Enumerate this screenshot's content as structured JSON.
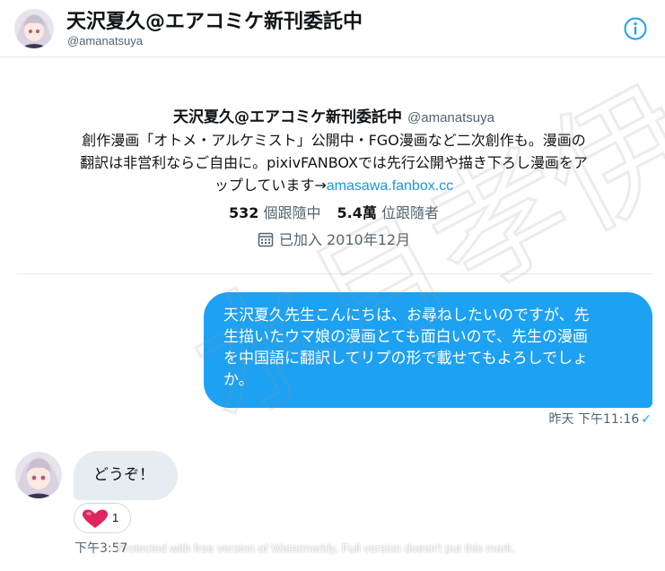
{
  "header": {
    "display_name": "天沢夏久@エアコミケ新刊委託中",
    "handle": "@amanatsuya",
    "info_icon": "info-icon"
  },
  "profile": {
    "display_name": "天沢夏久@エアコミケ新刊委託中",
    "handle": "@amanatsuya",
    "bio_line1": "創作漫画「オトメ・アルケミスト」公開中・FGO漫画など二次創作も。漫画の",
    "bio_line2": "翻訳は非営利ならご自由に。pixivFANBOXでは先行公開や描き下ろし漫画をア",
    "bio_line3": "ップしています→",
    "bio_link": "amasawa.fanbox.cc",
    "following_count": "532",
    "following_label": "個跟隨中",
    "followers_count": "5.4萬",
    "followers_label": "位跟隨者",
    "joined": "已加入 2010年12月",
    "calendar_icon": "calendar-icon"
  },
  "messages": {
    "outgoing_line1": "天沢夏久先生こんにちは、お尋ねしたいのですが、先",
    "outgoing_line2": "生描いたウマ娘の漫画とても面白いので、先生の漫画",
    "outgoing_line3": "を中国語に翻訳してリプの形で載せてもよろしでしょ",
    "outgoing_line4": "か。",
    "outgoing_time": "昨天 下午11:16",
    "outgoing_status": "✓",
    "incoming_text": "どうぞ！",
    "reaction_icon": "heart-icon",
    "reaction_count": "1",
    "incoming_time": "下午3:57"
  },
  "watermark": {
    "footer": "Protected with free version of Watermarkly. Full version doesn't put this mark.",
    "overlay_text": "水月孝伊"
  },
  "colors": {
    "accent": "#1da1f2",
    "link": "#1b95e0",
    "incoming_bubble": "#e6ecf0",
    "secondary_text": "#536471",
    "heart": "#e0245e"
  }
}
